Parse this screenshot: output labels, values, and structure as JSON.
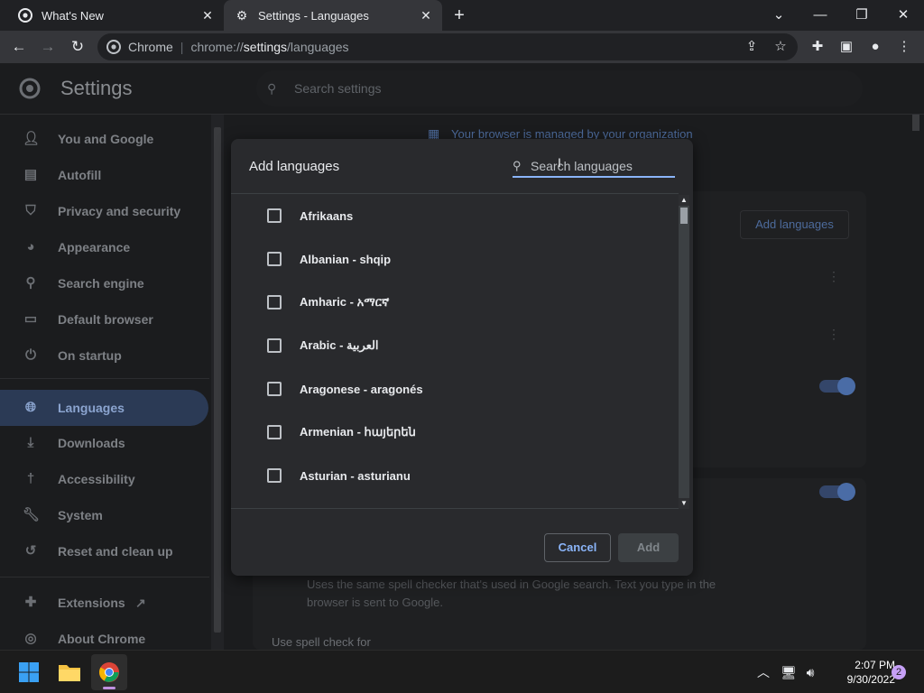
{
  "browser": {
    "tabs": [
      {
        "title": "What's New",
        "active": false
      },
      {
        "title": "Settings - Languages",
        "active": true
      }
    ],
    "omnibox": {
      "chip": "Chrome",
      "url_prefix": "chrome://",
      "url_bold": "settings",
      "url_suffix": "/languages"
    }
  },
  "settings": {
    "title": "Settings",
    "search_placeholder": "Search settings",
    "managed_notice": "Your browser is managed by your organization",
    "nav": [
      {
        "label": "You and Google",
        "icon": "person-icon"
      },
      {
        "label": "Autofill",
        "icon": "clipboard-icon"
      },
      {
        "label": "Privacy and security",
        "icon": "shield-icon"
      },
      {
        "label": "Appearance",
        "icon": "palette-icon"
      },
      {
        "label": "Search engine",
        "icon": "search-icon"
      },
      {
        "label": "Default browser",
        "icon": "browser-icon"
      },
      {
        "label": "On startup",
        "icon": "power-icon"
      },
      {
        "label": "Languages",
        "icon": "globe-icon",
        "active": true
      },
      {
        "label": "Downloads",
        "icon": "download-icon"
      },
      {
        "label": "Accessibility",
        "icon": "accessibility-icon"
      },
      {
        "label": "System",
        "icon": "wrench-icon"
      },
      {
        "label": "Reset and clean up",
        "icon": "history-icon"
      },
      {
        "label": "Extensions",
        "icon": "puzzle-icon"
      },
      {
        "label": "About Chrome",
        "icon": "chrome-icon"
      }
    ],
    "add_languages_label": "Add languages",
    "spell_check_desc": "Uses the same spell checker that's used in Google search. Text you type in the browser is sent to Google.",
    "spell_check_for": "Use spell check for"
  },
  "dialog": {
    "title": "Add languages",
    "search_placeholder": "Search languages",
    "languages": [
      "Afrikaans",
      "Albanian - shqip",
      "Amharic - አማርኛ",
      "Arabic - العربية",
      "Aragonese - aragonés",
      "Armenian - հայերեն",
      "Asturian - asturianu"
    ],
    "cancel_label": "Cancel",
    "add_label": "Add"
  },
  "taskbar": {
    "time": "2:07 PM",
    "date": "9/30/2022",
    "notification_count": "2"
  },
  "colors": {
    "accent": "#8ab4f8",
    "active_nav_bg": "#2b3a55",
    "dialog_bg": "#292a2d"
  }
}
